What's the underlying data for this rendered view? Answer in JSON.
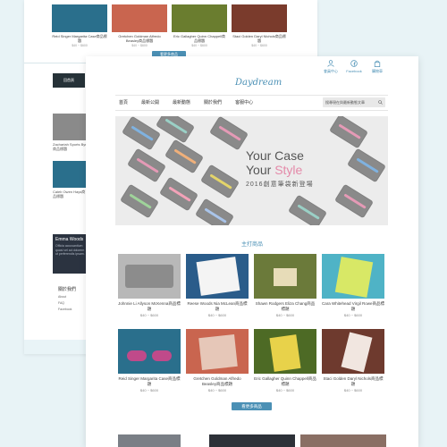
{
  "colors": {
    "accent": "#4b90b5",
    "pink": "#e48aa9",
    "page_bg": "#e8f3f6"
  },
  "background_card": {
    "top_products": [
      {
        "name": "Reid Singer Margarita Case商品標題",
        "price": "$40 ~ $600",
        "swatch": "#2a6f8c"
      },
      {
        "name": "Gretchen Goldman Alfredo Beasley商品標題",
        "price": "$40 ~ $600",
        "swatch": "#c9654f"
      },
      {
        "name": "Eric Gallagher Quinn Chappell商品標題",
        "price": "$40 ~ $600",
        "swatch": "#6a7d2f"
      },
      {
        "name": "Staci Golden Daryl Nichols商品標題",
        "price": "$40 ~ $600",
        "swatch": "#7a3b2c"
      }
    ],
    "more_label": "看更多商品",
    "nav_button": "回首頁",
    "side_items": [
      {
        "caption": "Zachariah Sports Byrd商品標題",
        "swatch": "#8a8a8a"
      },
      {
        "caption": "Caleb Owen Hays商品標題",
        "swatch": "#2a6f8c"
      }
    ],
    "emma": {
      "title": "Emma Woods",
      "text": "Officia accusantium quasi vel ad dolorem ut perferendis ipsam."
    },
    "about": {
      "title": "關於我們",
      "links": [
        "About",
        "FAQ",
        "Facebook"
      ]
    }
  },
  "header": {
    "icons": [
      {
        "icon": "user-icon",
        "label": "會員中心"
      },
      {
        "icon": "facebook-icon",
        "label": "Facebook"
      },
      {
        "icon": "cart-icon",
        "label": "購物車"
      }
    ],
    "logo": "Daydream"
  },
  "nav": {
    "items": [
      "首頁",
      "最新公開",
      "最新動態",
      "關於我們",
      "客服中心"
    ],
    "search_placeholder": "搜尋現在與最新動態文章"
  },
  "banner": {
    "line1": "Your Case",
    "line2_plain": "Your ",
    "line2_accent": "Style",
    "line3": "2016創意筆袋新登場"
  },
  "main": {
    "section_title": "主打商品",
    "products": [
      {
        "name": "Johnnie Li Allyson McKenna商品標題",
        "price": "$40 ~ $600",
        "swatch": "#b8b8b8"
      },
      {
        "name": "Reese Woods Nia McLean商品標題",
        "price": "$40 ~ $600",
        "swatch": "#2a5c8a"
      },
      {
        "name": "Shawn Rodgers Eliza Chang商品標題",
        "price": "$40 ~ $600",
        "swatch": "#6b7a3a"
      },
      {
        "name": "Cara Whitehead Virgil Rowe商品標題",
        "price": "$40 ~ $600",
        "swatch": "#4fb3c6"
      },
      {
        "name": "Reid Singer Margarita Case商品標題",
        "price": "$40 ~ $600",
        "swatch": "#2a6f8c"
      },
      {
        "name": "Gretchen Goldman Alfredo Beasley商品標題",
        "price": "$40 ~ $600",
        "swatch": "#c9654f"
      },
      {
        "name": "Eric Gallagher Quinn Chappell商品標題",
        "price": "$40 ~ $600",
        "swatch": "#4d6a25"
      },
      {
        "name": "Staci Golden Daryl Nichols商品標題",
        "price": "$40 ~ $600",
        "swatch": "#6e3a2e"
      }
    ],
    "more_label": "看更多商品"
  }
}
